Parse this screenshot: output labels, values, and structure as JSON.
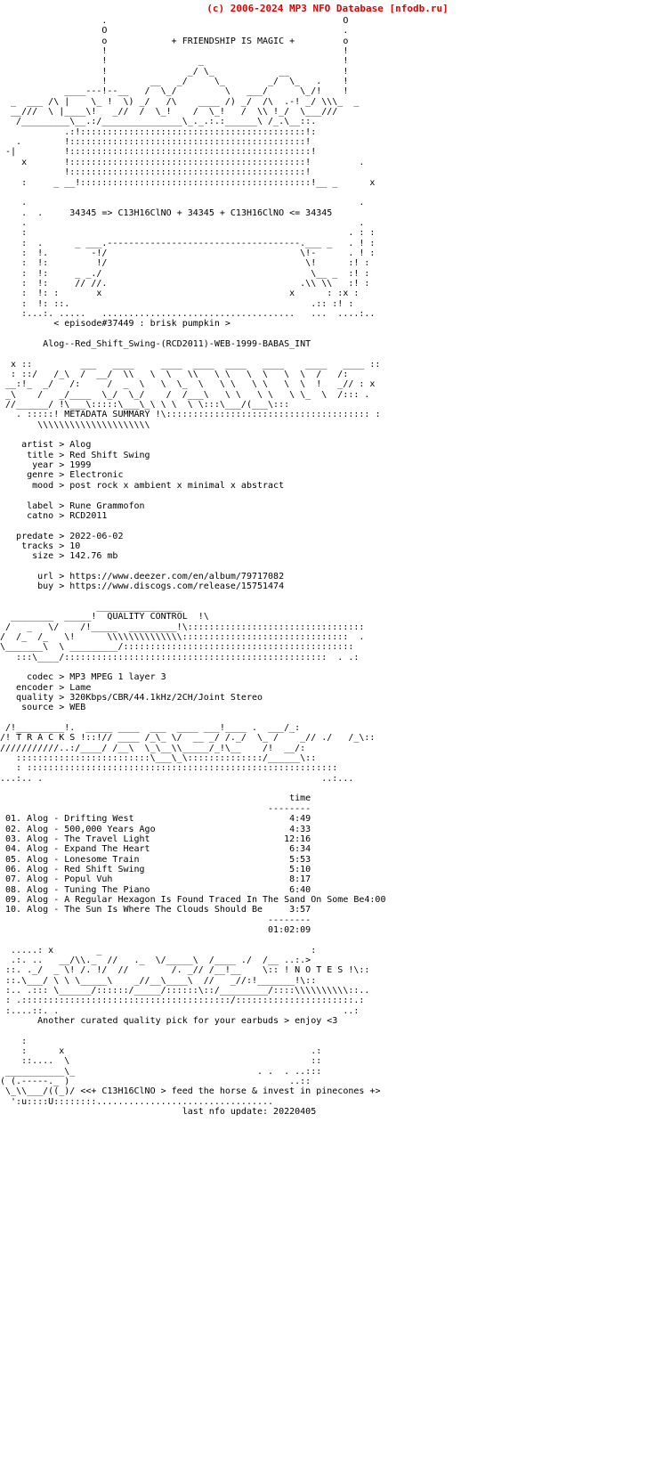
{
  "header": {
    "copyright": "(c) 2006-2024 MP3 NFO Database [nfodb.ru]",
    "color": "#e00000"
  },
  "banner": {
    "tagline": "+ FRIENDSHIP IS MAGIC +",
    "formula": "34345 => C13H16ClNO + 34345 + C13H16ClNO <= 34345",
    "episode": "< episode#37449 : brisk pumpkin >",
    "release": "Alog--Red_Shift_Swing-(RCD2011)-WEB-1999-BABAS_INT"
  },
  "sections": {
    "metadata_title": "METADATA SUMMARY",
    "quality_title": "QUALITY CONTROL",
    "tracks_title": "T R A C K S",
    "notes_title": "N O T E S"
  },
  "metadata": {
    "groups": [
      [
        {
          "key": "artist",
          "value": "Alog"
        },
        {
          "key": "title",
          "value": "Red Shift Swing"
        },
        {
          "key": "year",
          "value": "1999"
        },
        {
          "key": "genre",
          "value": "Electronic"
        },
        {
          "key": "mood",
          "value": "post rock x ambient x minimal x abstract"
        }
      ],
      [
        {
          "key": "label",
          "value": "Rune Grammofon"
        },
        {
          "key": "catno",
          "value": "RCD2011"
        }
      ],
      [
        {
          "key": "predate",
          "value": "2022-06-02"
        },
        {
          "key": "tracks",
          "value": "10"
        },
        {
          "key": "size",
          "value": "142.76 mb"
        }
      ],
      [
        {
          "key": "url",
          "value": "https://www.deezer.com/en/album/79717082"
        },
        {
          "key": "buy",
          "value": "https://www.discogs.com/release/15751474"
        }
      ]
    ]
  },
  "quality": {
    "fields": [
      {
        "key": "codec",
        "value": "MP3 MPEG 1 layer 3"
      },
      {
        "key": "encoder",
        "value": "Lame"
      },
      {
        "key": "quality",
        "value": "320Kbps/CBR/44.1kHz/2CH/Joint Stereo"
      },
      {
        "key": "source",
        "value": "WEB"
      }
    ]
  },
  "tracklist": {
    "time_header": "time",
    "rule": "--------",
    "items": [
      {
        "num": "01.",
        "artist": "Alog",
        "title": "Drifting West",
        "time": "4:49"
      },
      {
        "num": "02.",
        "artist": "Alog",
        "title": "500,000 Years Ago",
        "time": "4:33"
      },
      {
        "num": "03.",
        "artist": "Alog",
        "title": "The Travel Light",
        "time": "12:16"
      },
      {
        "num": "04.",
        "artist": "Alog",
        "title": "Expand The Heart",
        "time": "6:34"
      },
      {
        "num": "05.",
        "artist": "Alog",
        "title": "Lonesome Train",
        "time": "5:53"
      },
      {
        "num": "06.",
        "artist": "Alog",
        "title": "Red Shift Swing",
        "time": "5:10"
      },
      {
        "num": "07.",
        "artist": "Alog",
        "title": "Popul Vuh",
        "time": "8:17"
      },
      {
        "num": "08.",
        "artist": "Alog",
        "title": "Tuning The Piano",
        "time": "6:40"
      },
      {
        "num": "09.",
        "artist": "Alog",
        "title": "A Regular Hexagon Is Found Traced In The Sand On Some Be",
        "time": "4:00"
      },
      {
        "num": "10.",
        "artist": "Alog",
        "title": "The Sun Is Where The Clouds Should Be",
        "time": "3:57"
      }
    ],
    "total": "01:02:09"
  },
  "notes": {
    "message": "Another curated quality pick for your earbuds > enjoy <3",
    "signature": "<<+ C13H16ClNO > feed the horse & invest in pinecones +>",
    "last_update": "last nfo update: 20220405"
  },
  "ascii": {
    "top_art": [
      "                   .                                            O",
      "                   O                                            .",
      "                   o            + FRIENDSHIP IS MAGIC +         o",
      "                   !                                            !",
      "                   !                 _                          !",
      "                   !               _/ \\_            __          !",
      "                   !        __   _/     \\_        _/  \\_   .    !",
      "            ____---!--__   /  \\_/         \\   ___/      \\_/!    !",
      "  _  ___ /\\ |    \\_ !  \\) _/   /\\    ____ /) _/  /\\  .-! _/ \\\\\\_  _",
      "  __///  \\ |____\\!   _//  /  \\_!    /  \\_!   /  \\\\ !_/  \\___///",
      "   /_________\\__.:/_______________\\_._.:.:______\\ /_.\\__::.",
      "            .:!::::::::::::::::::::::::::::::::::::::::::!:",
      "   .        !::::::::::::::::::::::::::::::::::::::::::::!",
      " -|         !:::::::::::::::::::::::::::::::::::::::::::::!",
      "    x       !::::::::::::::::::::::::::::::::::::::::::::!         .",
      "            !::::::::::::::::::::::::::::::::::::::::::::!",
      "    :     _ __!:::::::::::::::::::::::::::::::::::::::::::!__ _      x"
    ],
    "bottom_frame": [
      "    .                                                         .",
      "    :  .        _ ___.------------------------------.___ _   . ! :",
      "    :  !.         -!/                              \\!-       . ! :",
      "    :  !:        !/                                  \\!       :! :",
      "    :  !:     _ _./                                   \\__ _   :! :",
      "    :  !: :   // //.                                 .\\\\ \\\\   : :x :",
      "    :  !: ::.            x                     x       .:: :! :",
      "    :...:. .....  ..................................  ...  ....:.."
    ]
  }
}
